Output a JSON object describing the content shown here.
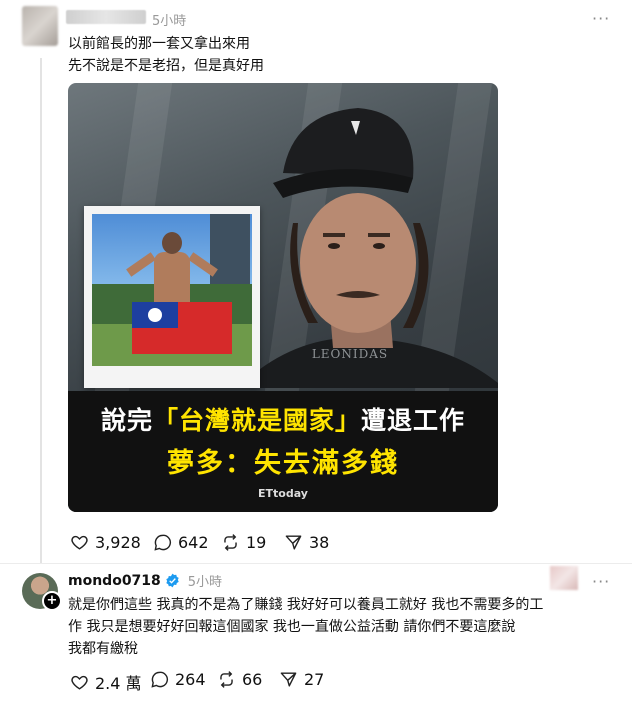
{
  "post1": {
    "time": "5小時",
    "more": "···",
    "line1": "以前館長的那一套又拿出來用",
    "line2": "先不說是不是老招，但是真好用",
    "image": {
      "headline_pre": "說完",
      "headline_quote": "「台灣就是國家」",
      "headline_post": "遭退工作",
      "subline": "夢多：失去滿多錢",
      "logo": "ETtoday",
      "shirt_text": "LEONIDAS",
      "colors": {
        "headline": "#ffffff",
        "quote": "#ffe400",
        "subline": "#ffe400",
        "banner": "#111111"
      }
    },
    "stats": {
      "likes": "3,928",
      "comments": "642",
      "reposts": "19",
      "shares": "38"
    }
  },
  "post2": {
    "username": "mondo0718",
    "time": "5小時",
    "more": "···",
    "line1": "就是你們這些 我真的不是為了賺錢 我好好可以養員工就好 我也不需要多的工",
    "line2": "作 我只是想要好好回報這個國家 我也一直做公益活動 請你們不要這麼說",
    "line3": "我都有繳稅",
    "stats": {
      "likes": "2.4 萬",
      "comments": "264",
      "reposts": "66",
      "shares": "27"
    },
    "colors": {
      "verified": "#1d9bf0"
    }
  }
}
